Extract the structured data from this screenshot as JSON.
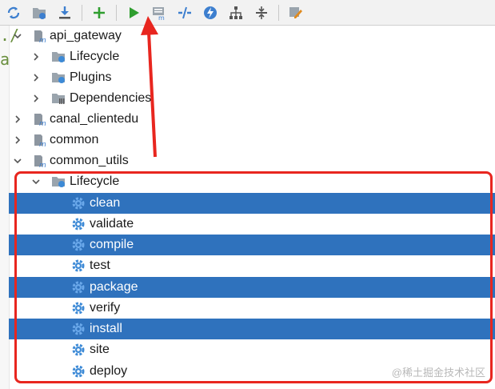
{
  "toolbar": {
    "buttons": [
      "reload-icon",
      "generate-sources-icon",
      "download-icon",
      "add-icon",
      "run-icon",
      "execute-goal-icon",
      "toggle-offline-icon",
      "skip-tests-icon",
      "show-dependencies-icon",
      "collapse-all-icon",
      "settings-icon"
    ]
  },
  "tree": {
    "api_gateway": "api_gateway",
    "lifecycle": "Lifecycle",
    "plugins": "Plugins",
    "dependencies": "Dependencies",
    "canal_clientedu": "canal_clientedu",
    "common": "common",
    "common_utils": "common_utils",
    "cu_lifecycle": "Lifecycle",
    "goals": [
      "clean",
      "validate",
      "compile",
      "test",
      "package",
      "verify",
      "install",
      "site",
      "deploy"
    ]
  },
  "watermark": "@稀土掘金技术社区",
  "colors": {
    "selection": "#2f72bd",
    "highlight_box": "#e8261f",
    "run_green": "#2f9e2f",
    "gear_blue": "#3d8ad6"
  }
}
